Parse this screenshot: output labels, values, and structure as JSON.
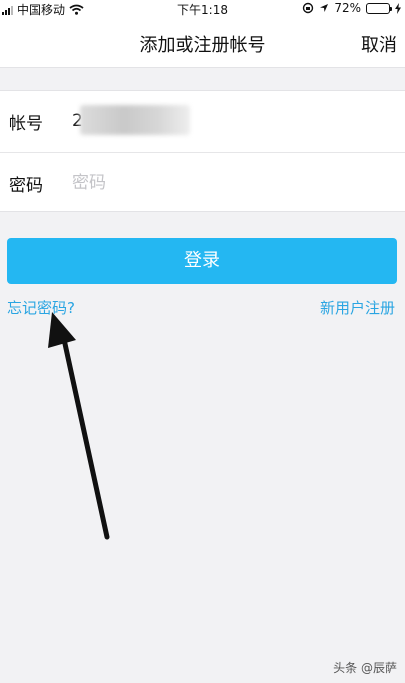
{
  "status_bar": {
    "carrier": "中国移动",
    "time": "下午1:18",
    "battery_percent": "72%",
    "battery_level": 0.72,
    "icons": [
      "signal-icon",
      "wifi-icon",
      "rotation-lock-icon",
      "location-icon",
      "battery-icon",
      "charging-icon"
    ]
  },
  "nav": {
    "title": "添加或注册帐号",
    "cancel_label": "取消"
  },
  "form": {
    "account_label": "帐号",
    "account_value": "2",
    "password_label": "密码",
    "password_placeholder": "密码"
  },
  "login_label": "登录",
  "links": {
    "forgot_password": "忘记密码?",
    "register": "新用户注册"
  },
  "annotation": {
    "arrow_color": "#111111"
  },
  "watermark": "头条 @辰萨",
  "colors": {
    "accent": "#24b7f2",
    "link": "#2aa5e2",
    "background": "#f2f2f4"
  }
}
